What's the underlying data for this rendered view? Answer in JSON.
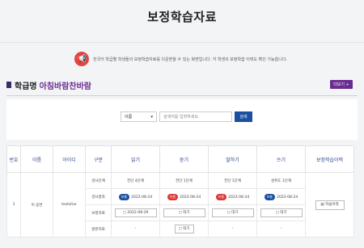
{
  "page": {
    "title": "보정학습자료"
  },
  "notice": {
    "text": "한국어 학급별 학생들의 보정학습자료를 다운받을 수 있는 화면입니다. 각 학생의 보정학습 이력도 확인 가능합니다."
  },
  "class_info": {
    "label": "학급명",
    "name": "아침바람찬바람",
    "more_button": "더보기 +"
  },
  "search": {
    "select_value": "이름",
    "placeholder": "검색어를 입력하세요.",
    "button": "검색"
  },
  "table": {
    "headers": [
      "번호",
      "이름",
      "아이디",
      "구분",
      "읽기",
      "듣기",
      "말하기",
      "쓰기",
      "보정학습이력"
    ],
    "row_labels": [
      "검사단계",
      "검사결과",
      "보정자료",
      "원본자료"
    ],
    "student": {
      "no": "1",
      "name": "이 승연",
      "id": "testsitar"
    },
    "levels": [
      "전단 4단계",
      "전단 1단계",
      "전단 1단계",
      "성취도 1단계"
    ],
    "results": [
      {
        "badge": "보통",
        "date": "2022-08-24"
      },
      {
        "badge": "미흡",
        "date": "2022-08-24"
      },
      {
        "badge": "미흡",
        "date": "2022-08-24"
      },
      {
        "badge": "보통",
        "date": "2022-08-24"
      }
    ],
    "materials": [
      "2022-08-29",
      "대기",
      "대기",
      "대기"
    ],
    "originals": [
      "-",
      "대기",
      "-",
      "-"
    ],
    "history_button": "학습이력"
  },
  "colors": {
    "accent": "#6b2c91",
    "blue": "#1c4fa0",
    "red": "#d93838"
  }
}
